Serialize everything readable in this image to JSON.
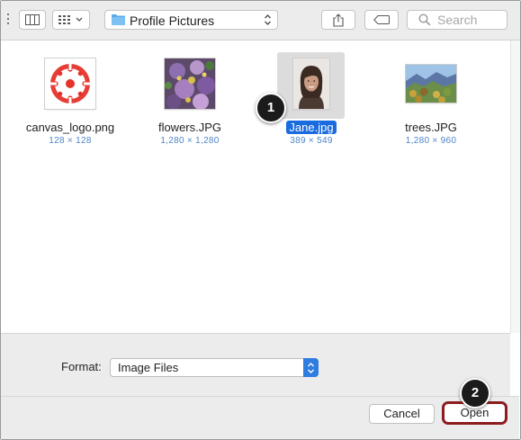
{
  "toolbar": {
    "location": "Profile Pictures",
    "search_placeholder": "Search",
    "icons": [
      "column-view-icon",
      "icon-view-icon",
      "folder-icon",
      "share-icon",
      "tag-icon",
      "search-icon"
    ]
  },
  "files": [
    {
      "name": "canvas_logo.png",
      "dims": "128 × 128"
    },
    {
      "name": "flowers.JPG",
      "dims": "1,280 × 1,280"
    },
    {
      "name": "Jane.jpg",
      "dims": "389 × 549",
      "selected": true
    },
    {
      "name": "trees.JPG",
      "dims": "1,280 × 960"
    }
  ],
  "callouts": {
    "one": "1",
    "two": "2"
  },
  "format": {
    "label": "Format:",
    "value": "Image Files"
  },
  "buttons": {
    "cancel": "Cancel",
    "open": "Open"
  },
  "colors": {
    "selection": "#1a6be0",
    "callout_ring": "#8c1c20",
    "dims_text": "#4e86c9",
    "canvas_red": "#e5332a"
  }
}
